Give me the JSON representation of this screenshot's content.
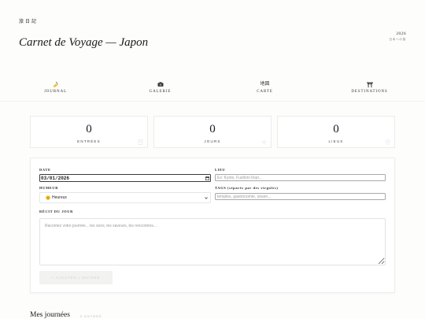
{
  "header": {
    "kanji": "旅日記",
    "title": "Carnet de Voyage — Japon",
    "year": "2026",
    "subtitle": "日本への旅"
  },
  "nav": {
    "tabs": [
      {
        "label": "JOURNAL",
        "icon": "writing-hand-icon"
      },
      {
        "label": "GALERIE",
        "icon": "camera-icon"
      },
      {
        "label": "CARTE",
        "icon_text": "地図"
      },
      {
        "label": "DESTINATIONS",
        "icon": "torii-icon"
      }
    ]
  },
  "stats": [
    {
      "value": "0",
      "label": "ENTRÉES",
      "icon": "faded-page-icon"
    },
    {
      "value": "0",
      "label": "JOURS",
      "icon": "faded-sun-icon"
    },
    {
      "value": "0",
      "label": "LIEUX",
      "icon": "faded-pin-icon"
    }
  ],
  "form": {
    "date_label": "DATE",
    "date_value": "03/01/2026",
    "place_label": "LIEU",
    "place_placeholder": "Ex: Kyoto, Fushimi Inari...",
    "mood_label": "HUMEUR",
    "mood_icon": "smiley-icon",
    "mood_value": "Heureux",
    "tags_label": "TAGS (séparés par des virgules)",
    "tags_placeholder": "temples, gastronomie, onsen...",
    "story_label": "RÉCIT DU JOUR",
    "story_placeholder": "Racontez votre journée... les sons, les saveurs, les rencontres...",
    "submit_label": "+ AJOUTER L'ENTRÉE"
  },
  "journal": {
    "title": "Mes journées",
    "count": "0 ENTRÉE"
  },
  "colors": {
    "text": "#1e1e1e",
    "border": "#ededed",
    "placeholder": "#9a9a9a",
    "emoji_yellow": "#f4c02a"
  }
}
